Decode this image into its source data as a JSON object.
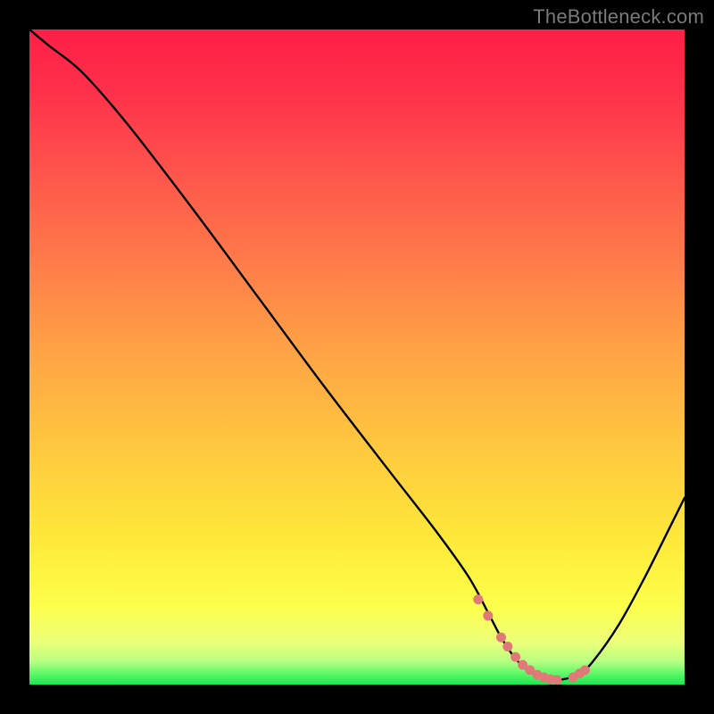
{
  "watermark": "TheBottleneck.com",
  "gradient_stops": [
    {
      "offset": 0,
      "color": "#ff1f47"
    },
    {
      "offset": 0.09,
      "color": "#ff2f4a"
    },
    {
      "offset": 0.2,
      "color": "#ff4f4c"
    },
    {
      "offset": 0.35,
      "color": "#ff7a4a"
    },
    {
      "offset": 0.5,
      "color": "#ffa545"
    },
    {
      "offset": 0.65,
      "color": "#ffcb3e"
    },
    {
      "offset": 0.78,
      "color": "#ffe93a"
    },
    {
      "offset": 0.88,
      "color": "#fdff4a"
    },
    {
      "offset": 0.935,
      "color": "#ecff7a"
    },
    {
      "offset": 0.965,
      "color": "#b8ff82"
    },
    {
      "offset": 0.985,
      "color": "#55f766"
    },
    {
      "offset": 1.0,
      "color": "#18e84e"
    }
  ],
  "chart_data": {
    "type": "line",
    "title": "",
    "xlabel": "",
    "ylabel": "",
    "xlim": [
      0,
      100
    ],
    "ylim": [
      0,
      100
    ],
    "grid": false,
    "series": [
      {
        "name": "bottleneck-curve",
        "x": [
          0,
          3,
          8,
          15,
          25,
          35,
          45,
          55,
          62,
          67,
          70,
          72,
          74,
          76,
          78,
          80,
          82,
          84,
          86,
          90,
          94,
          98,
          100
        ],
        "values": [
          100,
          97.5,
          93.5,
          85.5,
          72.5,
          59,
          45.5,
          32.5,
          23.5,
          16.5,
          11,
          7.2,
          4.2,
          2.2,
          1.1,
          0.7,
          0.9,
          1.7,
          3.5,
          9.2,
          16.5,
          24.5,
          28.5
        ]
      }
    ],
    "markers": {
      "name": "highlight-dots",
      "color": "#e07a78",
      "x": [
        68.5,
        70.0,
        72.0,
        73.0,
        74.2,
        75.3,
        76.4,
        77.5,
        78.5,
        79.5,
        80.5,
        83.0,
        84.0,
        84.8
      ],
      "values": [
        13.0,
        10.5,
        7.2,
        5.8,
        4.2,
        3.0,
        2.2,
        1.5,
        1.1,
        0.8,
        0.7,
        1.1,
        1.7,
        2.2
      ]
    }
  }
}
